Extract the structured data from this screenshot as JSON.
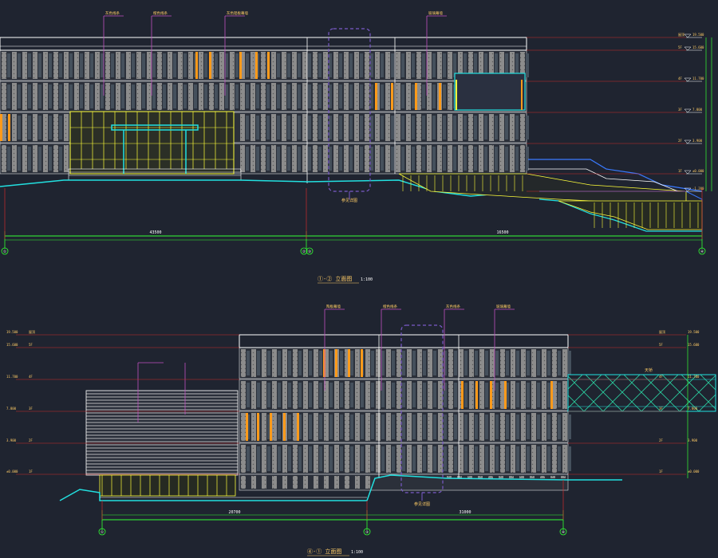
{
  "drawing": {
    "background": "#1f2430",
    "colors": {
      "wall": "#ffffff",
      "panel": "#8c8c8c",
      "window": "#4a5560",
      "orange": "#ff9a1a",
      "yellow": "#ffff3a",
      "cyan": "#22e0e0",
      "red": "#cc2a2a",
      "magenta": "#c050c0",
      "purple": "#7a5ac8",
      "green": "#33ff33",
      "blue": "#3a7aff",
      "label": "#ffcc66"
    }
  },
  "elevation_top": {
    "title": "①-② 立面图",
    "scale": "1:100",
    "callouts": [
      "灰色线条",
      "橙色线条",
      "灰色铝板幕墙",
      "玻璃幕墙"
    ],
    "dims": [
      "43500",
      "　",
      "16500"
    ],
    "axis_marks": [
      "①",
      "②",
      "③",
      "④"
    ],
    "level_labels": [
      "19.500",
      "15.600",
      "11.700",
      "7.800",
      "3.900",
      "±0.000",
      "-1.200"
    ],
    "floor_labels": [
      "屋顶",
      "5F",
      "4F",
      "3F",
      "2F",
      "1F"
    ],
    "box_note": "参见详图"
  },
  "elevation_bottom": {
    "title": "④-① 立面图",
    "scale": "1:100",
    "callouts": [
      "陶板幕墙",
      "橙色线条",
      "灰色线条",
      "玻璃幕墙"
    ],
    "dims": [
      "20700",
      "31000"
    ],
    "axis_marks": [
      "①",
      "③",
      "④"
    ],
    "level_labels": [
      "19.500",
      "15.600",
      "11.700",
      "7.800",
      "3.900",
      "±0.000"
    ],
    "floor_labels": [
      "屋顶",
      "5F",
      "4F",
      "3F",
      "2F",
      "1F"
    ],
    "side_labels": [
      "天桥"
    ],
    "box_note": "参见详图"
  }
}
